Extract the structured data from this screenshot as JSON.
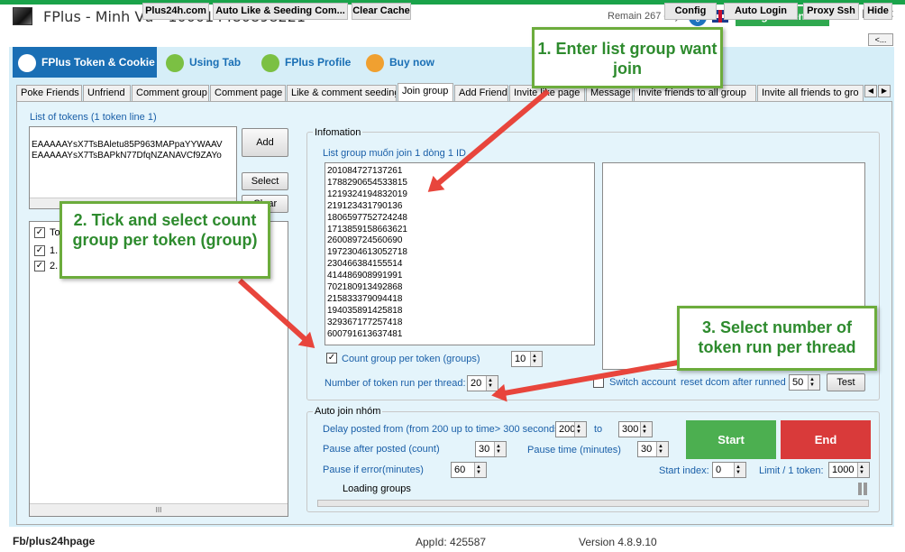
{
  "window": {
    "title": "FPlus - Minh Vũ - 100014480898221",
    "remain": "Remain 267 days",
    "login_label": "Login license",
    "back_label": "<..."
  },
  "main_tabs": [
    "FPlus Token & Cookie",
    "Using Tab",
    "FPlus Profile",
    "Buy now"
  ],
  "sub_tabs": [
    "Poke Friends",
    "Unfriend",
    "Comment group",
    "Comment page",
    "Like & comment seeding",
    "Join group",
    "Add Friend",
    "Invite like page",
    "Message",
    "Invite friends to all group",
    "Invite all friends to gro"
  ],
  "tokens": {
    "label": "List of tokens (1 token line 1)",
    "lines": [
      "EAAAAAYsX7TsBAletu85P963MAPpaYYWAAV",
      "EAAAAAYsX7TsBAPkN77DfqNZANAVCf9ZAYo"
    ],
    "add": "Add",
    "select": "Select",
    "clear": "Clear",
    "list_header": "To",
    "rows": [
      "1.",
      "2."
    ]
  },
  "info": {
    "legend": "Infomation",
    "list_label": "List group muốn join 1 dòng 1 ID",
    "group_ids": [
      "201084727137261",
      "1788290654533815",
      "1219324194832019",
      "219123431790136",
      "1806597752724248",
      "1713859158663621",
      "260089724560690",
      "1972304613052718",
      "230466384155514",
      "414486908991991",
      "702180913492868",
      "215833379094418",
      "194035891425818",
      "329367177257418",
      "600791613637481"
    ],
    "count_group_label": "Count group per token (groups)",
    "count_group_value": "10",
    "token_per_thread_label": "Number of token run per thread:",
    "token_per_thread_value": "20",
    "switch_label": "Switch account",
    "reset_label": "reset dcom after runned",
    "reset_value": "50",
    "test": "Test"
  },
  "auto": {
    "legend": "Auto join nhóm",
    "delay_label": "Delay posted from (from 200 up to time> 300 seconds)",
    "delay_from": "200",
    "to": "to",
    "delay_to": "300",
    "pause_posted_label": "Pause after posted (count)",
    "pause_posted_value": "30",
    "pause_time_label": "Pause time (minutes)",
    "pause_time_value": "30",
    "pause_error_label": "Pause if error(minutes)",
    "pause_error_value": "60",
    "start_index_label": "Start index:",
    "start_index_value": "0",
    "limit_label": "Limit / 1 token:",
    "limit_value": "1000",
    "start": "Start",
    "end": "End",
    "loading": "Loading groups"
  },
  "callouts": {
    "c1": "1. Enter list group want join",
    "c2": "2. Tick and select count group per token (group)",
    "c3": "3. Select number of token run per thread"
  },
  "bottom": {
    "fb": "Fb/plus24hpage",
    "plus24h": "Plus24h.com",
    "autolike": "Auto Like & Seeding Com...",
    "clear_cache": "Clear Cache",
    "appid": "AppId: 425587",
    "version": "Version 4.8.9.10",
    "config": "Config",
    "autologin": "Auto Login",
    "proxy": "Proxy Ssh",
    "hide": "Hide"
  },
  "colors": {
    "accent_green": "#2fa84f",
    "end_red": "#d93a3a",
    "tab_blue": "#1a6fb5"
  }
}
